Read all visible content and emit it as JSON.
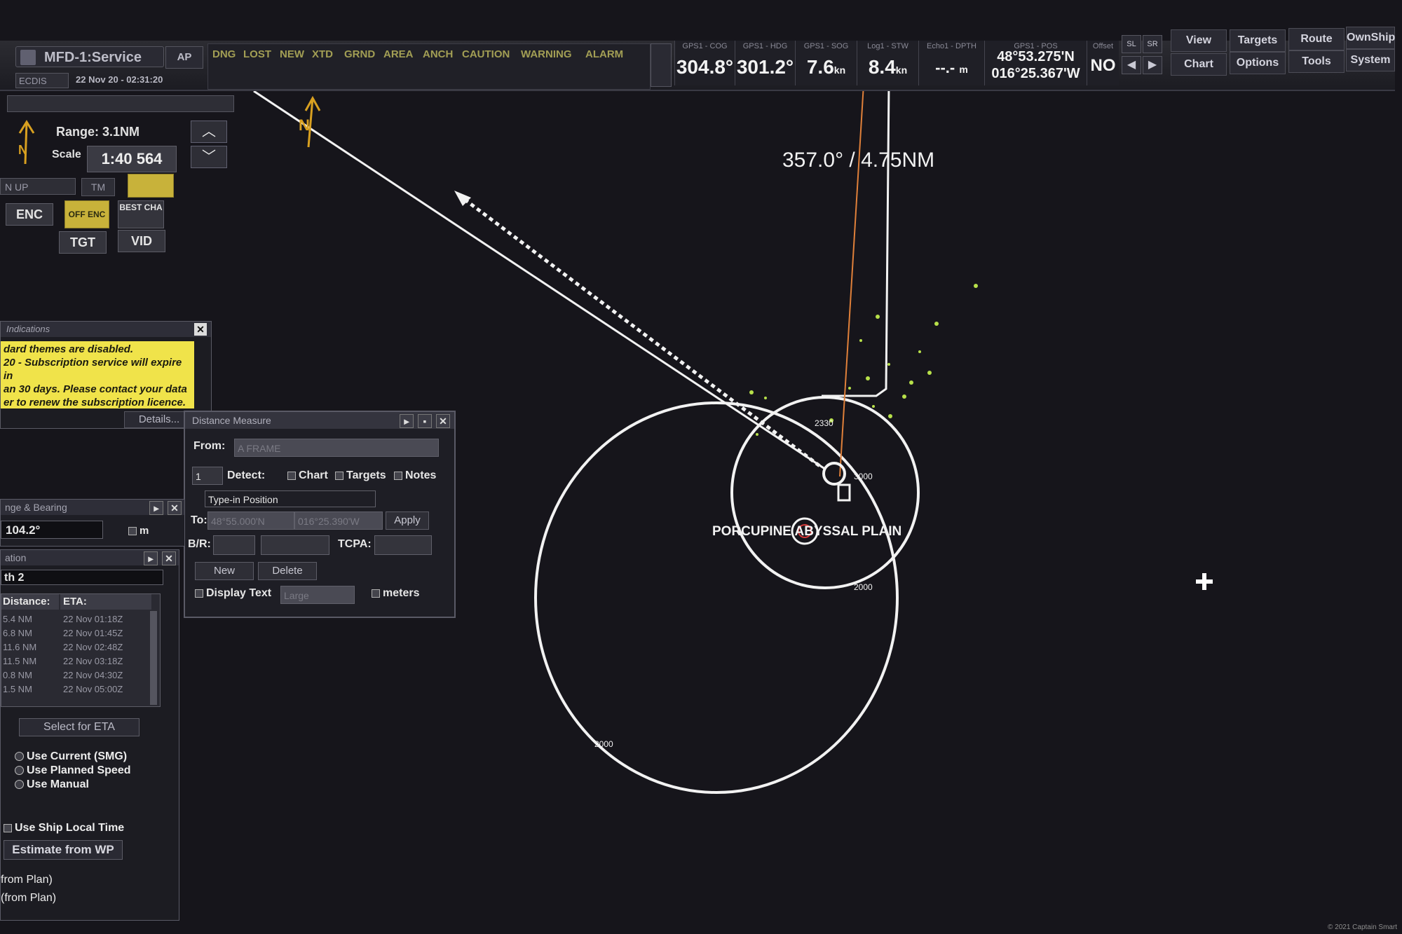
{
  "window": {
    "title": "MFD-1:Service",
    "mode": "ECDIS",
    "datetime": "22 Nov 20 - 02:31:20"
  },
  "toolbar": {
    "ap_label": "AP",
    "alarm_items": [
      "DNG",
      "LOST",
      "NEW",
      "XTD",
      "GRND",
      "AREA",
      "ANCH",
      "CAUTION",
      "WARNING",
      "ALARM"
    ],
    "nav_cells": [
      {
        "label": "GPS1 - COG",
        "value": "304.8°"
      },
      {
        "label": "GPS1 - HDG",
        "value": "301.2°"
      },
      {
        "label": "GPS1 - SOG",
        "value": "7.6",
        "unit": "kn"
      },
      {
        "label": "Log1 - STW",
        "value": "8.4",
        "unit": "kn"
      },
      {
        "label": "Echo1 - DPTH",
        "value": "--.-",
        "unit": "m"
      }
    ],
    "position": {
      "label": "GPS1 - POS",
      "lat": "48°53.275'N",
      "lon": "016°25.367'W"
    },
    "offset": {
      "label": "Offset",
      "value": "NO"
    },
    "sl_label": "SL",
    "sr_label": "SR",
    "menu_top": [
      "View",
      "Targets",
      "Route",
      "OwnShip"
    ],
    "menu_bottom": [
      "Chart",
      "Options",
      "Tools",
      "System"
    ]
  },
  "range_panel": {
    "range_label": "Range: 3.1NM",
    "scale_label": "Scale",
    "scale_value": "1:40 564",
    "orientation": "N UP",
    "motion": "TM",
    "btn_enc": "ENC",
    "btn_yellow": "OFF ENC",
    "btn_best_cha": "BEST CHA",
    "btn_tgt": "TGT",
    "btn_vid": "VID"
  },
  "indications": {
    "title": "Indications",
    "lines": [
      "dard themes are disabled.",
      "20 - Subscription service will expire in",
      "an 30 days. Please contact your data",
      "er to renew the subscription licence."
    ],
    "details_label": "Details..."
  },
  "distance_measure": {
    "title": "Distance Measure",
    "from_label": "From:",
    "from_value": "A FRAME",
    "count_value": "1",
    "detect_label": "Detect:",
    "detect_options": [
      "Chart",
      "Targets",
      "Notes"
    ],
    "type_in_label": "Type-in Position",
    "to_label": "To:",
    "to_lat": "48°55.000'N",
    "to_lon": "016°25.390'W",
    "apply_label": "Apply",
    "br_label": "B/R:",
    "tcpa_label": "TCPA:",
    "new_label": "New",
    "delete_label": "Delete",
    "display_text_label": "Display Text",
    "display_size": "Large",
    "meters_label": "meters"
  },
  "range_bearing": {
    "title": "nge & Bearing",
    "value": "104.2°",
    "unit_label": "m"
  },
  "estimation": {
    "title": "ation",
    "route": "th 2",
    "col_distance": "Distance:",
    "col_eta": "ETA:",
    "rows": [
      {
        "distance": "5.4 NM",
        "eta": "22 Nov 01:18Z"
      },
      {
        "distance": "6.8 NM",
        "eta": "22 Nov 01:45Z"
      },
      {
        "distance": "11.6 NM",
        "eta": "22 Nov 02:48Z"
      },
      {
        "distance": "11.5 NM",
        "eta": "22 Nov 03:18Z"
      },
      {
        "distance": "0.8 NM",
        "eta": "22 Nov 04:30Z"
      },
      {
        "distance": "1.5 NM",
        "eta": "22 Nov 05:00Z"
      }
    ],
    "select_label": "Select for ETA",
    "options": [
      "Use Current (SMG)",
      "Use Planned Speed",
      "Use Manual"
    ],
    "local_time_label": "Use Ship Local Time",
    "estimate_label": "Estimate from WP",
    "from_plan_1": "from Plan)",
    "from_plan_2": "(from Plan)"
  },
  "chart": {
    "bearing_label": "357.0° / 4.75NM",
    "feature_label": "PORCUPINE ABYSSAL PLAIN",
    "depth_labels": [
      "2000",
      "2000",
      "3000",
      "2330",
      "3000"
    ],
    "colors": {
      "background": "#16151b",
      "line": "#f2f2f2",
      "heading_line": "#e0803a",
      "targets": "#b7e04a",
      "north_arrow": "#d8a020"
    }
  },
  "copyright": "© 2021 Captain Smart"
}
